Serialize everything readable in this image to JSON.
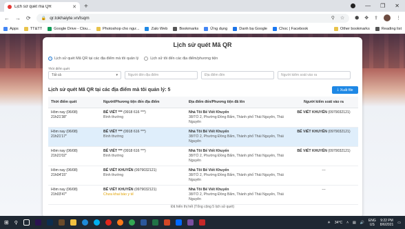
{
  "browser": {
    "tab_title": "Lịch sử quét mã QR",
    "url": "qr.tokhaiyte.vn/lsqm",
    "bookmarks": [
      {
        "label": "Apps",
        "color": "#4285f4"
      },
      {
        "label": "TT&TT",
        "color": "#e8c34b"
      },
      {
        "label": "Google Drive - Clou...",
        "color": "#0f9d58"
      },
      {
        "label": "Photoshop cho ngư...",
        "color": "#e8c34b"
      },
      {
        "label": "Zalo Web",
        "color": "#1e88e5"
      },
      {
        "label": "Bookmarks",
        "color": "#555555"
      },
      {
        "label": "Ứng dụng",
        "color": "#4285f4"
      },
      {
        "label": "Danh bạ Google",
        "color": "#1a73e8"
      },
      {
        "label": "Choc | Facebook",
        "color": "#1877f2"
      }
    ],
    "bookmarks_right": [
      {
        "label": "Other bookmarks",
        "color": "#e8c34b"
      },
      {
        "label": "Reading list",
        "color": "#555555"
      }
    ]
  },
  "page": {
    "title": "Lịch sử quét Mã QR",
    "radio_options": [
      "Lịch sử quét Mã QR tại các địa điểm mà tôi quản lý",
      "Lịch sử tôi đến các địa điểm/phương tiện"
    ],
    "filter_time_label": "Thời điểm quét",
    "filter_time_value": "Tất cả",
    "filter_person_placeholder": "Người đến địa điểm",
    "filter_place_placeholder": "Địa điểm đến",
    "filter_controller_placeholder": "Người kiểm soát vào ra",
    "list_heading": "Lịch sử quét Mã QR tại các địa điểm mà tôi quản lý: 5",
    "export_label": "Xuất file",
    "columns": [
      "Thời điểm quét",
      "Người/Phương tiện đến địa điểm",
      "Địa điểm đến/Phương tiện đã lên",
      "Người kiểm soát vào ra"
    ],
    "rows": [
      {
        "date": "Hôm nay (06/08)",
        "time": "21h21'38''",
        "person": "BẾ VIẾT ***",
        "phone": "(0918 616 ***)",
        "status": "Bình thường",
        "place": "Nhà Tôi Bế Viết Khuyến",
        "address": "38/TỔ 2, Phường Đồng Bẩm, Thành phố Thái Nguyên, Thái Nguyên",
        "controller": "BẾ VIẾT KHUYẾN",
        "controller_phone": "(0979032121)"
      },
      {
        "date": "Hôm nay (06/08)",
        "time": "21h21'17''",
        "person": "BẾ VIẾT ***",
        "phone": "(0918 616 ***)",
        "status": "Bình thường",
        "place": "Nhà Tôi Bế Viết Khuyến",
        "address": "38/TỔ 2, Phường Đồng Bẩm, Thành phố Thái Nguyên, Thái Nguyên",
        "controller": "BẾ VIẾT KHUYẾN",
        "controller_phone": "(0979032121)"
      },
      {
        "date": "Hôm nay (06/08)",
        "time": "21h21'02''",
        "person": "BẾ VIẾT ***",
        "phone": "(0918 616 ***)",
        "status": "Bình thường",
        "place": "Nhà Tôi Bế Viết Khuyến",
        "address": "38/TỔ 2, Phường Đồng Bẩm, Thành phố Thái Nguyên, Thái Nguyên",
        "controller": "BẾ VIẾT KHUYẾN",
        "controller_phone": "(0979032121)"
      },
      {
        "date": "Hôm nay (06/08)",
        "time": "21h04'15''",
        "person": "BẾ VIẾT KHUYẾN",
        "phone": "(0979032121)",
        "status": "Bình thường",
        "place": "Nhà Tôi Bế Viết Khuyến",
        "address": "38/TỔ 2, Phường Đồng Bẩm, Thành phố Thái Nguyên, Thái Nguyên",
        "controller": "---",
        "controller_phone": ""
      },
      {
        "date": "Hôm nay (06/08)",
        "time": "21h03'47''",
        "person": "BẾ VIẾT KHUYẾN",
        "phone": "(0979032121)",
        "status": "Chưa khai báo y tế",
        "place": "Nhà Tôi Bế Viết Khuyến",
        "address": "38/TỔ 2, Phường Đồng Bẩm, Thành phố Thái Nguyên, Thái Nguyên",
        "controller": "---",
        "controller_phone": ""
      }
    ],
    "footer": "Đã hiển thị hết (Tổng cộng 5 lịch sử quét)"
  },
  "taskbar": {
    "weather": "34°C",
    "lang_top": "ENG",
    "lang_bottom": "US",
    "time": "9:22 PM",
    "date": "8/6/2021"
  }
}
